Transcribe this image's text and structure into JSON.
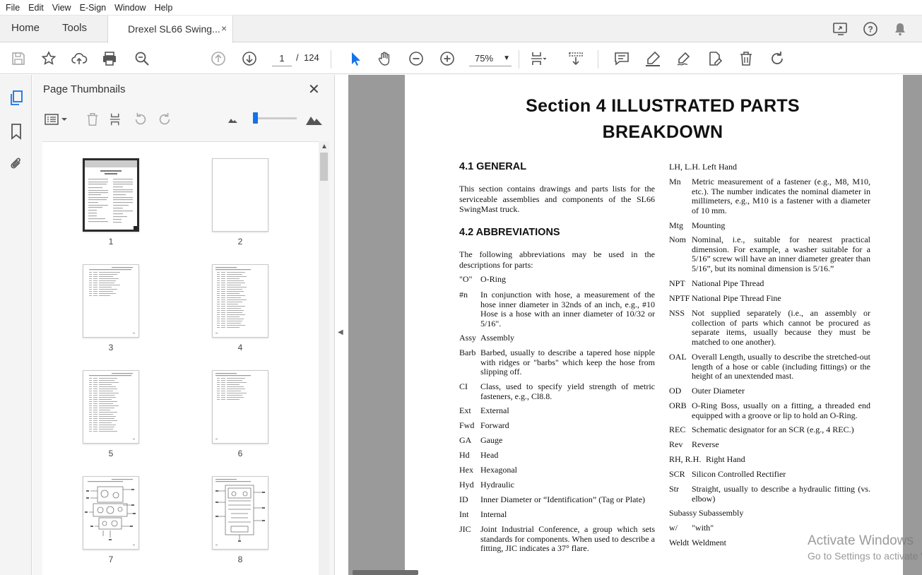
{
  "menu": [
    "File",
    "Edit",
    "View",
    "E-Sign",
    "Window",
    "Help"
  ],
  "tabs": {
    "home": "Home",
    "tools": "Tools",
    "document": "Drexel SL66 Swing...",
    "close": "×"
  },
  "toolbar": {
    "page_current": "1",
    "page_sep": "/",
    "page_total": "124",
    "zoom": "75%"
  },
  "panel": {
    "title": "Page Thumbnails",
    "close": "✕"
  },
  "thumbnails": [
    "1",
    "2",
    "3",
    "4",
    "5",
    "6",
    "7",
    "8"
  ],
  "document": {
    "heading_line1": "Section 4 ILLUSTRATED PARTS",
    "heading_line2": "BREAKDOWN",
    "general_title": "4.1 GENERAL",
    "general_text": "This section contains drawings and parts lists for the serviceable assemblies and components of the SL66 SwingMast truck.",
    "abbr_title": "4.2 ABBREVIATIONS",
    "abbr_intro": "The following abbreviations may be used in the descriptions for parts:",
    "left_abbreviations": [
      {
        "k": "\"O\"",
        "v": "O-Ring"
      },
      {
        "k": "#n",
        "v": "In conjunction with hose, a measurement of the hose inner diameter in 32nds of an inch, e.g., #10 Hose is a hose with an inner diameter of 10/32 or 5/16\"."
      },
      {
        "k": "Assy",
        "v": "Assembly"
      },
      {
        "k": "Barb",
        "v": "Barbed, usually to describe a tapered hose nipple with ridges or \"barbs\" which keep the hose from slipping off."
      },
      {
        "k": "CI",
        "v": "Class, used to specify yield strength of metric fasteners, e.g., Cl8.8."
      },
      {
        "k": "Ext",
        "v": "External"
      },
      {
        "k": "Fwd",
        "v": "Forward"
      },
      {
        "k": "GA",
        "v": "Gauge"
      },
      {
        "k": "Hd",
        "v": "Head"
      },
      {
        "k": "Hex",
        "v": "Hexagonal"
      },
      {
        "k": "Hyd",
        "v": "Hydraulic"
      },
      {
        "k": "ID",
        "v": "Inner Diameter or “Identification” (Tag or Plate)"
      },
      {
        "k": "Int",
        "v": "Internal"
      },
      {
        "k": "JIC",
        "v": "Joint Industrial Conference, a group which sets standards for components. When used to describe a fitting, JIC indicates a 37° flare."
      }
    ],
    "right_abbreviations": [
      {
        "k": "LH, L.H.",
        "v": "Left Hand"
      },
      {
        "k": "Mn",
        "v": "Metric measurement of a fastener (e.g., M8, M10, etc.). The number indicates the nominal diameter in millimeters, e.g., M10 is a fastener with a diameter of 10 mm."
      },
      {
        "k": "Mtg",
        "v": "Mounting"
      },
      {
        "k": "Nom",
        "v": "Nominal, i.e., suitable for nearest practical dimension. For example, a washer suitable for a 5/16” screw will have an inner diameter greater than 5/16”, but its nominal dimension is 5/16.”"
      },
      {
        "k": "NPT",
        "v": "National Pipe Thread"
      },
      {
        "k": "NPTF",
        "v": "National Pipe Thread Fine"
      },
      {
        "k": "NSS",
        "v": "Not supplied separately (i.e., an assembly or collection of parts which cannot be procured as separate items, usually because they must be matched to one another)."
      },
      {
        "k": "OAL",
        "v": "Overall Length, usually to describe the stretched-out length of a hose or cable (including fittings) or the height of an unextended mast."
      },
      {
        "k": "OD",
        "v": "Outer Diameter"
      },
      {
        "k": "ORB",
        "v": "O-Ring Boss, usually on a fitting, a threaded end equipped with a groove or lip to hold an O-Ring."
      },
      {
        "k": "REC",
        "v": "Schematic designator for an SCR (e.g., 4 REC.)"
      },
      {
        "k": "Rev",
        "v": "Reverse"
      },
      {
        "k": "RH, R.H.",
        "v": "Right Hand"
      },
      {
        "k": "SCR",
        "v": "Silicon Controlled Rectifier"
      },
      {
        "k": "Str",
        "v": "Straight, usually to describe a hydraulic fitting (vs. elbow)"
      },
      {
        "k": "Subassy",
        "v": "Subassembly"
      },
      {
        "k": "w/",
        "v": "\"with\""
      },
      {
        "k": "Weldt",
        "v": "Weldment"
      }
    ]
  },
  "watermark": {
    "line1": "Activate Windows",
    "line2": "Go to Settings to activate Windows."
  }
}
